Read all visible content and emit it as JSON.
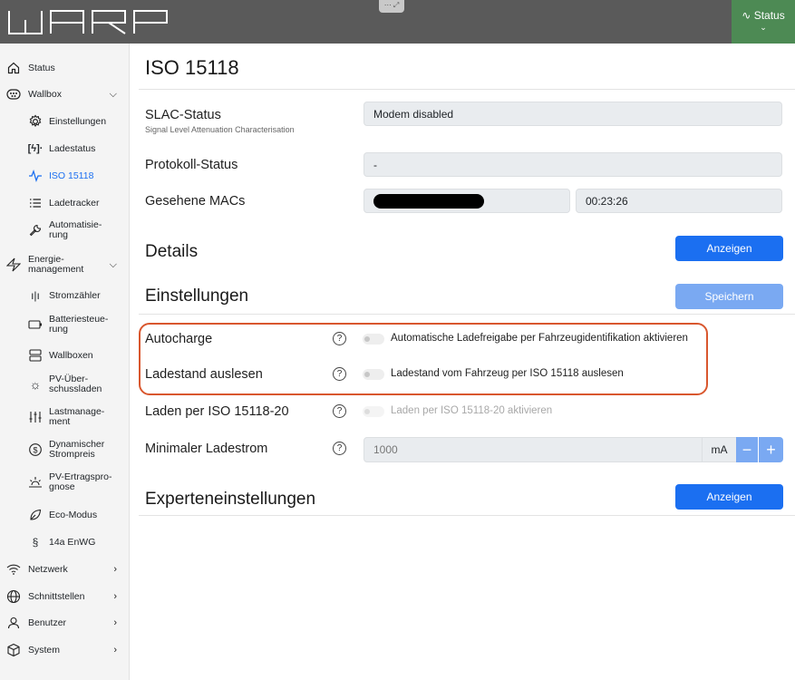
{
  "header": {
    "status_label": "Status",
    "status_icon": "pulse-icon",
    "brand_color": "#4d8a54"
  },
  "sidebar": {
    "items": [
      {
        "label": "Status",
        "icon": "home-icon"
      },
      {
        "label": "Wallbox",
        "icon": "wallbox-icon"
      },
      {
        "label": "Einstellungen",
        "icon": "gear-icon"
      },
      {
        "label": "Ladestatus",
        "icon": "charging-icon"
      },
      {
        "label": "ISO 15118",
        "icon": "pulse-icon",
        "active": true
      },
      {
        "label": "Ladetracker",
        "icon": "list-icon"
      },
      {
        "label": "Automatisie-\nrung",
        "icon": "wrench-icon"
      },
      {
        "label": "Energie-\nmanagement",
        "icon": "bolt-icon"
      },
      {
        "label": "Stromzähler",
        "icon": "meter-icon"
      },
      {
        "label": "Batteriesteue-\nrung",
        "icon": "battery-icon"
      },
      {
        "label": "Wallboxen",
        "icon": "server-icon"
      },
      {
        "label": "PV-Über-\nschussladen",
        "icon": "sun-icon"
      },
      {
        "label": "Lastmanage-\nment",
        "icon": "sliders-icon"
      },
      {
        "label": "Dynamischer\nStrompreis",
        "icon": "dollar-cycle-icon"
      },
      {
        "label": "PV-Ertragspro-\ngnose",
        "icon": "sunrise-icon"
      },
      {
        "label": "Eco-Modus",
        "icon": "leaf-icon"
      },
      {
        "label": "14a EnWG",
        "icon": "paragraph-icon"
      },
      {
        "label": "Netzwerk",
        "icon": "wifi-icon"
      },
      {
        "label": "Schnittstellen",
        "icon": "globe-icon"
      },
      {
        "label": "Benutzer",
        "icon": "user-icon"
      },
      {
        "label": "System",
        "icon": "box-icon"
      }
    ]
  },
  "main": {
    "title": "ISO 15118",
    "slac": {
      "label": "SLAC-Status",
      "sublabel": "Signal Level Attenuation Characterisation",
      "value": "Modem disabled"
    },
    "protocol": {
      "label": "Protokoll-Status",
      "value": "-"
    },
    "macs": {
      "label": "Gesehene MACs",
      "time": "00:23:26"
    },
    "details": {
      "title": "Details",
      "button": "Anzeigen"
    },
    "settings": {
      "title": "Einstellungen",
      "save": "Speichern"
    },
    "autocharge": {
      "label": "Autocharge",
      "switch_label": "Automatische Ladefreigabe per Fahrzeugidentifikation aktivieren"
    },
    "soc": {
      "label": "Ladestand auslesen",
      "switch_label": "Ladestand vom Fahrzeug per ISO 15118 auslesen"
    },
    "iso20": {
      "label": "Laden per ISO 15118-20",
      "switch_label": "Laden per ISO 15118-20 aktivieren"
    },
    "min_current": {
      "label": "Minimaler Ladestrom",
      "value": "1000",
      "unit": "mA",
      "minus": "−",
      "plus": "+"
    },
    "expert": {
      "title": "Experteneinstellungen",
      "button": "Anzeigen"
    },
    "help_glyph": "?"
  }
}
